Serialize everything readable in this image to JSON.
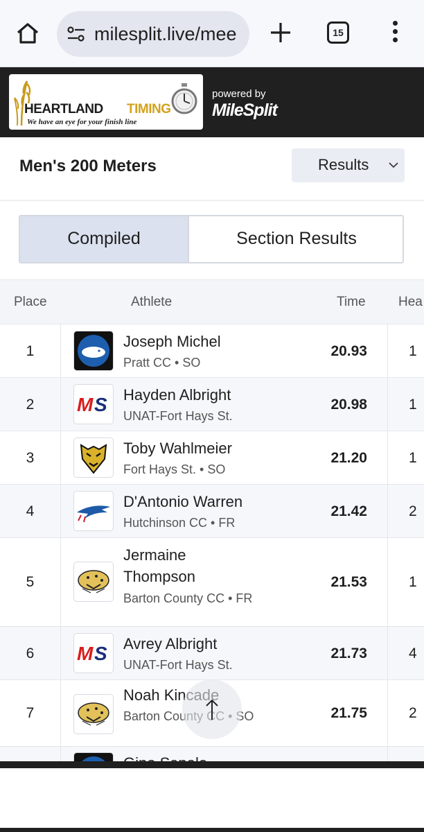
{
  "browser": {
    "url": "milesplit.live/mee",
    "tab_count": "15"
  },
  "header": {
    "logo_word1": "HEARTLAND",
    "logo_word2": "TIMING",
    "logo_tagline": "We have an eye for your finish line",
    "powered_by": "powered by",
    "brand": "MileSplit"
  },
  "event": {
    "title": "Men's 200 Meters",
    "view_select": "Results"
  },
  "tabs": [
    {
      "label": "Compiled",
      "active": true
    },
    {
      "label": "Section Results",
      "active": false
    }
  ],
  "table": {
    "headers": {
      "place": "Place",
      "athlete": "Athlete",
      "time": "Time",
      "heat": "Hea"
    },
    "rows": [
      {
        "place": "1",
        "name": "Joseph Michel",
        "team": "Pratt CC • SO",
        "time": "20.93",
        "heat": "1",
        "logo": "pratt-beaver-icon"
      },
      {
        "place": "2",
        "name": "Hayden Albright",
        "team": "UNAT-Fort Hays St.",
        "time": "20.98",
        "heat": "1",
        "logo": "milesplit-ms-icon"
      },
      {
        "place": "3",
        "name": "Toby Wahlmeier",
        "team": "Fort Hays St. • SO",
        "time": "21.20",
        "heat": "1",
        "logo": "tiger-icon"
      },
      {
        "place": "4",
        "name": "D'Antonio Warren",
        "team": "Hutchinson CC • FR",
        "time": "21.42",
        "heat": "2",
        "logo": "blue-dragon-icon"
      },
      {
        "place": "5",
        "name": "Jermaine Thompson",
        "team": "Barton County CC • FR",
        "time": "21.53",
        "heat": "1",
        "logo": "cougar-icon"
      },
      {
        "place": "6",
        "name": "Avrey Albright",
        "team": "UNAT-Fort Hays St.",
        "time": "21.73",
        "heat": "4",
        "logo": "milesplit-ms-icon"
      },
      {
        "place": "7",
        "name": "Noah Kincade",
        "team": "Barton County CC • SO",
        "time": "21.75",
        "heat": "2",
        "logo": "cougar-icon"
      },
      {
        "place": "",
        "name": "Gino Sapalo",
        "team": "",
        "time": "",
        "heat": "",
        "logo": "pratt-beaver-icon"
      }
    ]
  }
}
